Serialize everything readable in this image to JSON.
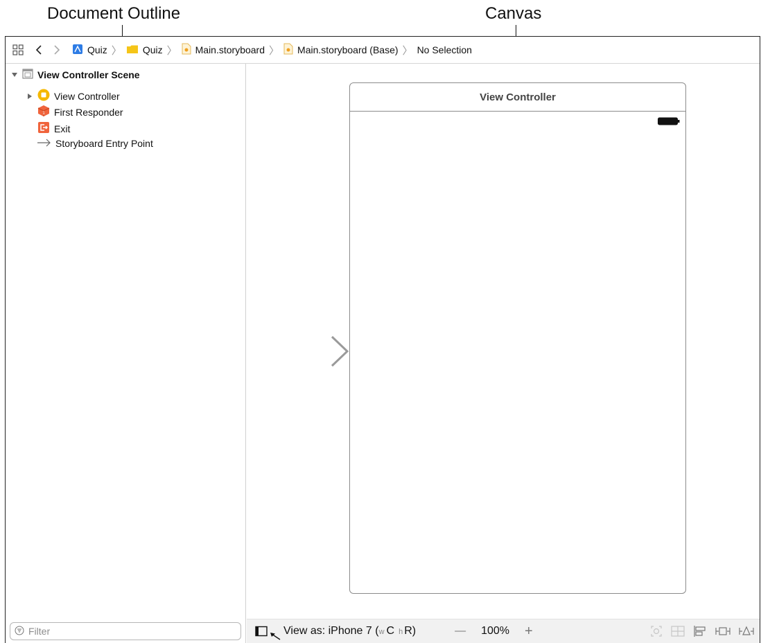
{
  "callouts": {
    "document_outline": "Document Outline",
    "canvas": "Canvas"
  },
  "jumpbar": {
    "crumbs": [
      {
        "label": "Quiz",
        "icon": "project-icon"
      },
      {
        "label": "Quiz",
        "icon": "folder-icon"
      },
      {
        "label": "Main.storyboard",
        "icon": "storyboard-file-icon"
      },
      {
        "label": "Main.storyboard (Base)",
        "icon": "storyboard-file-icon"
      },
      {
        "label": "No Selection",
        "icon": ""
      }
    ]
  },
  "outline": {
    "scene": "View Controller Scene",
    "items": [
      {
        "label": "View Controller",
        "icon": "view-controller-icon"
      },
      {
        "label": "First Responder",
        "icon": "first-responder-icon"
      },
      {
        "label": "Exit",
        "icon": "exit-icon"
      },
      {
        "label": "Storyboard Entry Point",
        "icon": "entry-arrow-icon"
      }
    ],
    "filter_placeholder": "Filter"
  },
  "scene": {
    "title": "View Controller"
  },
  "bottombar": {
    "view_as_prefix": "View as: iPhone 7 (",
    "size_w": "w",
    "size_c": "C",
    "size_h": "h",
    "size_r": "R",
    "size_close": ")",
    "zoom_minus": "—",
    "zoom": "100%",
    "zoom_plus": "+"
  },
  "colors": {
    "accent_yellow": "#f5b800",
    "exit_orange": "#f0643c",
    "project_blue": "#2e7ce5",
    "folder_yellow": "#f5c518"
  }
}
